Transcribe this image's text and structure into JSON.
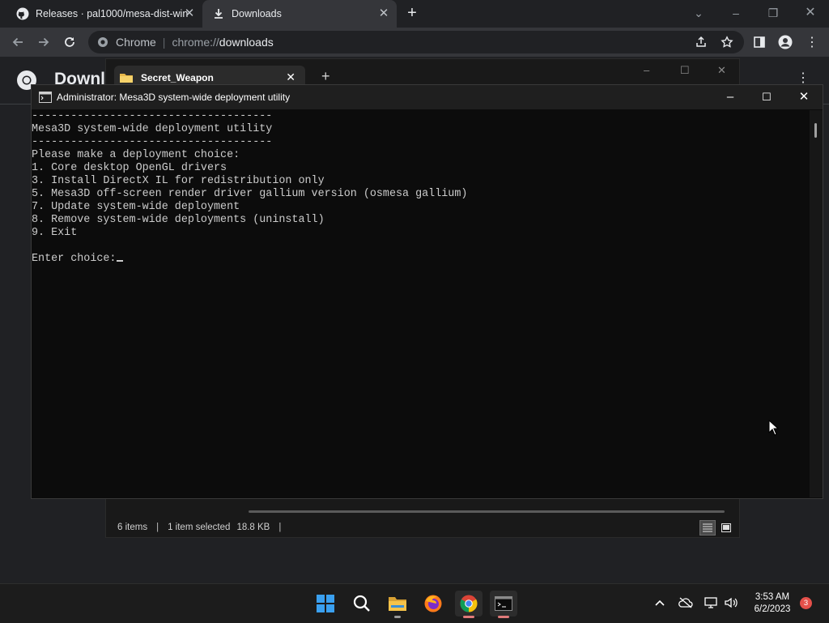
{
  "chrome": {
    "tabs": [
      {
        "title": "Releases · pal1000/mesa-dist-win",
        "icon": "github-icon"
      },
      {
        "title": "Downloads",
        "icon": "download-icon"
      }
    ],
    "omnibox": {
      "chip": "Chrome",
      "scheme": "chrome://",
      "path": "downloads"
    }
  },
  "downloads_page": {
    "title": "Downl"
  },
  "explorer": {
    "tab_title": "Secret_Weapon",
    "status": {
      "items": "6 items",
      "selected": "1 item selected",
      "size": "18.8 KB"
    }
  },
  "console": {
    "title": "Administrator:  Mesa3D system-wide deployment utility",
    "lines": [
      "-------------------------------------",
      "Mesa3D system-wide deployment utility",
      "-------------------------------------",
      "Please make a deployment choice:",
      "1. Core desktop OpenGL drivers",
      "3. Install DirectX IL for redistribution only",
      "5. Mesa3D off-screen render driver gallium version (osmesa gallium)",
      "7. Update system-wide deployment",
      "8. Remove system-wide deployments (uninstall)",
      "9. Exit",
      "",
      "Enter choice:"
    ]
  },
  "taskbar": {
    "apps": [
      "windows-start-icon",
      "search-icon",
      "file-explorer-icon",
      "firefox-icon",
      "chrome-icon",
      "terminal-icon"
    ],
    "clock": {
      "time": "3:53 AM",
      "date": "6/2/2023"
    },
    "notification_count": "3"
  },
  "colors": {
    "console_bg": "#0c0c0c",
    "console_text": "#cccccc",
    "badge": "#e5504a"
  }
}
